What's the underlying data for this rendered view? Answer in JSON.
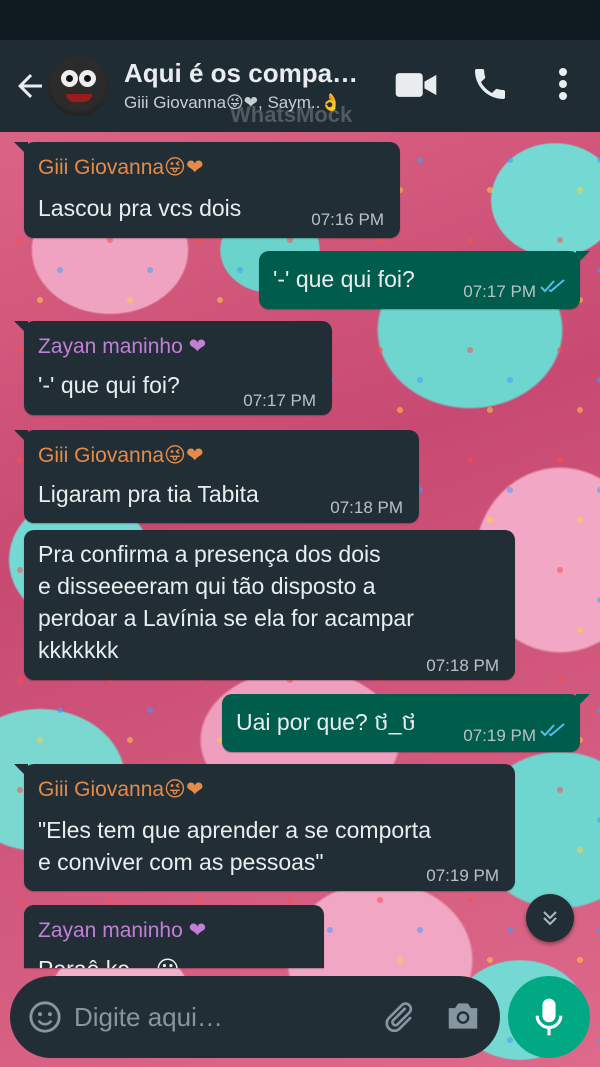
{
  "header": {
    "title": "Aqui é os compar…",
    "members": "Giii Giovanna😜❤, Saym..👌",
    "watermark": "WhatsMock"
  },
  "messages": [
    {
      "direction": "in",
      "sender": "Giii Giovanna😜❤",
      "sender_color": "#e58b4a",
      "text": "Lascou pra vcs dois",
      "time": "07:16 PM"
    },
    {
      "direction": "out",
      "text": "'-' que qui foi?",
      "time": "07:17 PM",
      "status": "read"
    },
    {
      "direction": "in",
      "sender": "Zayan maninho ❤",
      "sender_color": "#c27fd6",
      "text": "'-' que qui foi?",
      "time": "07:17 PM"
    },
    {
      "direction": "in",
      "sender": "Giii Giovanna😜❤",
      "sender_color": "#e58b4a",
      "text": "Ligaram pra tia Tabita",
      "time": "07:18 PM"
    },
    {
      "direction": "in",
      "lines": [
        "Pra confirma a presença dos dois",
        "e disseeeeram qui tão disposto a",
        "perdoar a Lavínia se ela for acampar",
        "kkkkkkk"
      ],
      "time": "07:18 PM"
    },
    {
      "direction": "out",
      "text": "Uai por que? ថ_ថ",
      "time": "07:19 PM",
      "status": "read"
    },
    {
      "direction": "in",
      "sender": "Giii Giovanna😜❤",
      "sender_color": "#e58b4a",
      "lines": [
        "\"Eles tem que aprender a se comporta",
        "e conviver com as pessoas\""
      ],
      "time": "07:19 PM"
    },
    {
      "direction": "in",
      "sender": "Zayan maninho ❤",
      "sender_color": "#c27fd6",
      "text": "Peraê ke... 😮",
      "time": ""
    }
  ],
  "composer": {
    "placeholder": "Digite aqui…"
  },
  "icons": {
    "back": "arrow-left-icon",
    "video": "video-camera-icon",
    "phone": "phone-icon",
    "menu": "more-vertical-icon",
    "emoji": "emoji-icon",
    "attach": "paperclip-icon",
    "camera": "camera-icon",
    "mic": "microphone-icon",
    "scroll": "chevron-double-down-icon"
  },
  "colors": {
    "header_bg": "#1f2c34",
    "incoming_bubble": "#222e35",
    "outgoing_bubble": "#005c4b",
    "accent": "#00a884",
    "read_ticks": "#53bdeb"
  }
}
